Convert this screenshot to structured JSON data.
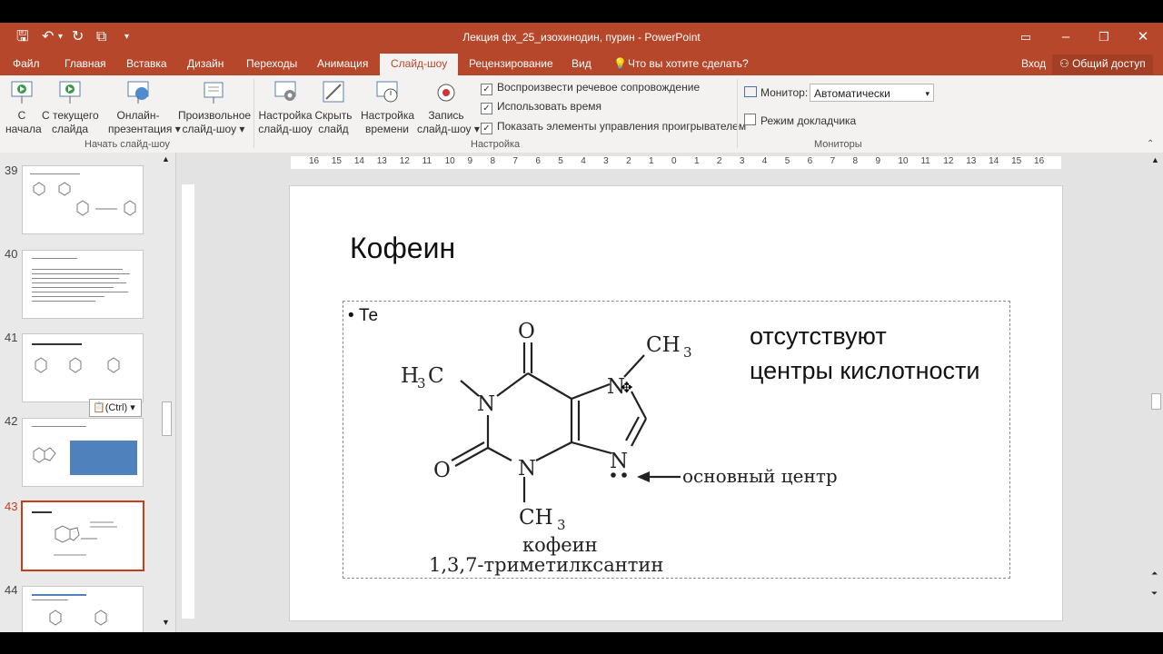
{
  "window": {
    "title": "Лекция фх_25_изохинодин, пурин - PowerPoint"
  },
  "tabs": [
    {
      "label": "Файл"
    },
    {
      "label": "Главная"
    },
    {
      "label": "Вставка"
    },
    {
      "label": "Дизайн"
    },
    {
      "label": "Переходы"
    },
    {
      "label": "Анимация"
    },
    {
      "label": "Слайд-шоу"
    },
    {
      "label": "Рецензирование"
    },
    {
      "label": "Вид"
    },
    {
      "label": "Что вы хотите сделать?"
    }
  ],
  "account": {
    "signin": "Вход",
    "share": "Общий доступ"
  },
  "ribbon": {
    "start_group": {
      "label": "Начать слайд-шоу",
      "from_start": [
        "С",
        "начала"
      ],
      "from_current": [
        "С текущего",
        "слайда"
      ],
      "online": [
        "Онлайн-",
        "презентация"
      ],
      "custom": [
        "Произвольное",
        "слайд-шоу"
      ]
    },
    "setup_group": {
      "label": "Настройка",
      "setup": [
        "Настройка",
        "слайд-шоу"
      ],
      "hide": [
        "Скрыть",
        "слайд"
      ],
      "timing": [
        "Настройка",
        "времени"
      ],
      "record": [
        "Запись",
        "слайд-шоу"
      ],
      "cb_narration": "Воспроизвести речевое сопровождение",
      "cb_timing": "Использовать время",
      "cb_controls": "Показать элементы управления проигрывателем"
    },
    "monitors_group": {
      "label": "Мониторы",
      "monitor_label": "Монитор:",
      "monitor_value": "Автоматически",
      "presenter_view": "Режим докладчика"
    }
  },
  "thumbnails": [
    {
      "num": "39"
    },
    {
      "num": "40"
    },
    {
      "num": "41"
    },
    {
      "num": "42"
    },
    {
      "num": "43"
    },
    {
      "num": "44"
    }
  ],
  "paste_badge": "(Ctrl)",
  "ruler_labels": [
    "16",
    "15",
    "14",
    "13",
    "12",
    "11",
    "10",
    "9",
    "8",
    "7",
    "6",
    "5",
    "4",
    "3",
    "2",
    "1",
    "0",
    "1",
    "2",
    "3",
    "4",
    "5",
    "6",
    "7",
    "8",
    "9",
    "10",
    "11",
    "12",
    "13",
    "14",
    "15",
    "16"
  ],
  "slide": {
    "title": "Кофеин",
    "bullet_text": "Те",
    "note_line1": "отсутствуют",
    "note_line2": "центры кислотности",
    "atoms": {
      "o_top": "O",
      "ch3_right": "CH",
      "h3c": "H",
      "c_h3c": "C",
      "n1": "N",
      "n7": "N",
      "n9": "N",
      "n3": "N",
      "o_left": "O",
      "ch3_bottom": "CH",
      "sub3": "3"
    },
    "basic_center": "основный центр",
    "caption_name": "кофеин",
    "caption_formula": "1,3,7-триметилксантин"
  },
  "colors": {
    "accent": "#b7472a",
    "selected_thumb": "#c43e1c"
  }
}
